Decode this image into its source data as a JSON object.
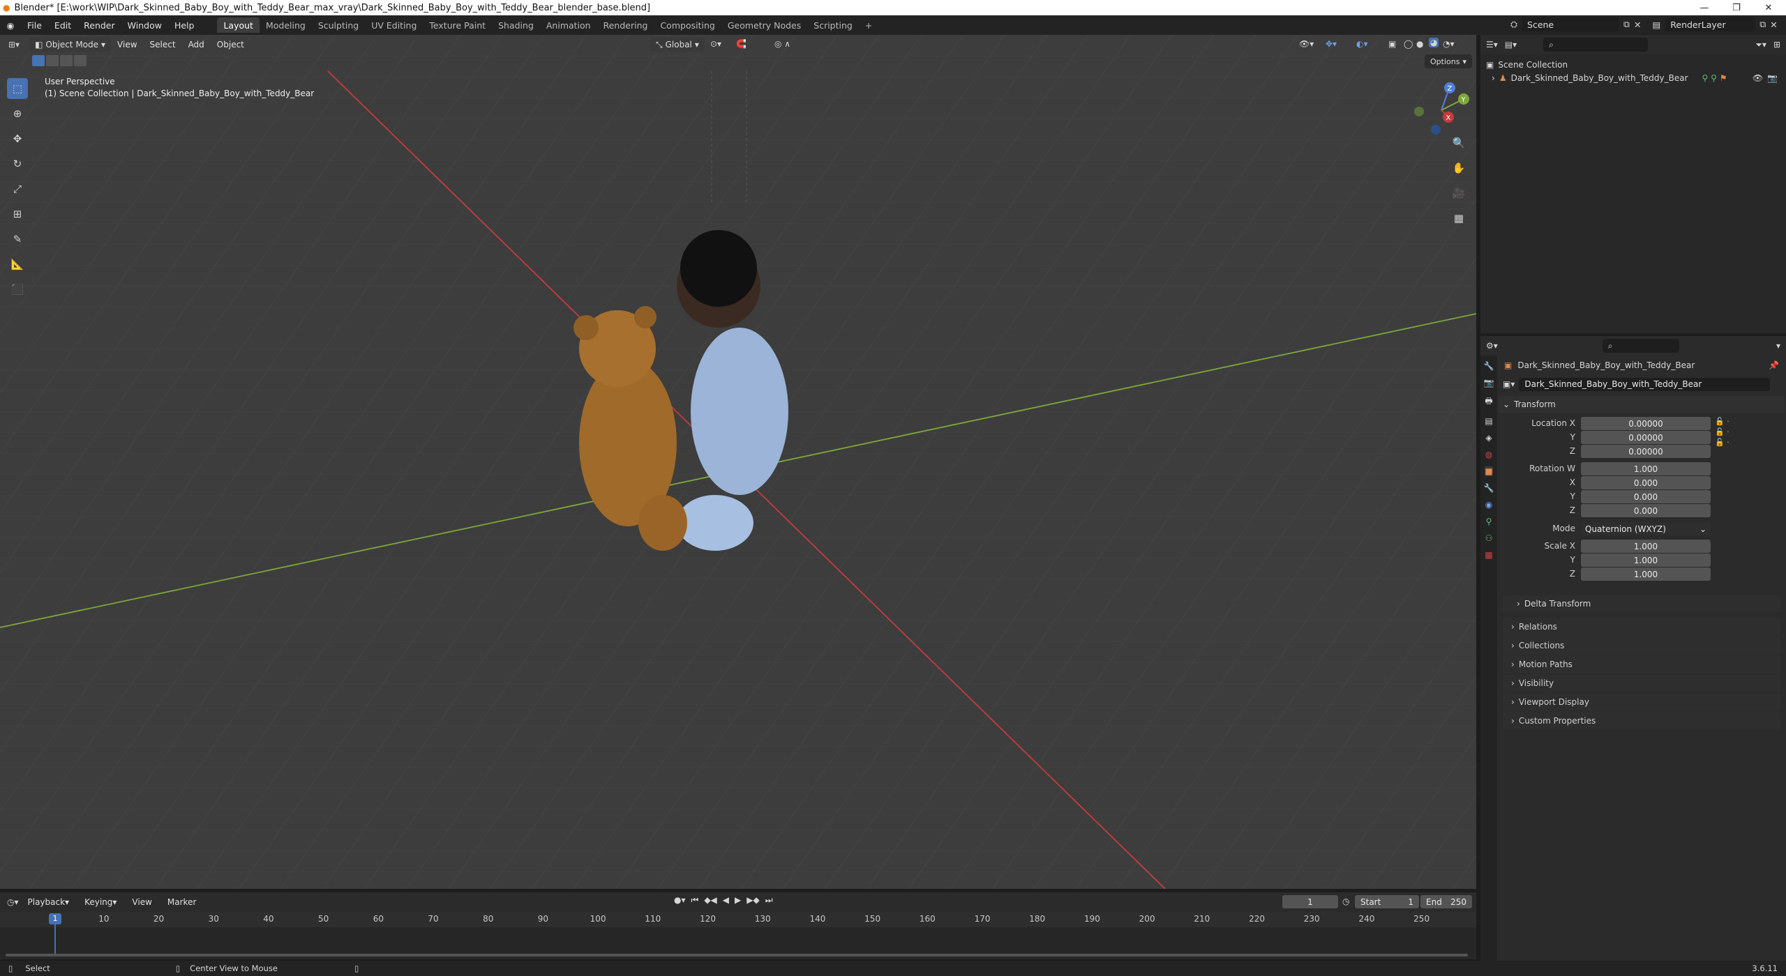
{
  "window": {
    "title": "Blender* [E:\\work\\WIP\\Dark_Skinned_Baby_Boy_with_Teddy_Bear_max_vray\\Dark_Skinned_Baby_Boy_with_Teddy_Bear_blender_base.blend]"
  },
  "menu": [
    "File",
    "Edit",
    "Render",
    "Window",
    "Help"
  ],
  "workspaces": [
    "Layout",
    "Modeling",
    "Sculpting",
    "UV Editing",
    "Texture Paint",
    "Shading",
    "Animation",
    "Rendering",
    "Compositing",
    "Geometry Nodes",
    "Scripting"
  ],
  "scene": {
    "name": "Scene",
    "render_layer": "RenderLayer"
  },
  "viewport": {
    "mode": "Object Mode",
    "menus": [
      "View",
      "Select",
      "Add",
      "Object"
    ],
    "transform_orientation": "Global",
    "options_label": "Options",
    "perspective": "User Perspective",
    "collection_info": "(1) Scene Collection | Dark_Skinned_Baby_Boy_with_Teddy_Bear"
  },
  "outliner": {
    "root": "Scene Collection",
    "items": [
      {
        "name": "Dark_Skinned_Baby_Boy_with_Teddy_Bear"
      }
    ]
  },
  "properties": {
    "object_name": "Dark_Skinned_Baby_Boy_with_Teddy_Bear",
    "object_field": "Dark_Skinned_Baby_Boy_with_Teddy_Bear",
    "transform_title": "Transform",
    "location_label": "Location X",
    "location": [
      "0.00000",
      "0.00000",
      "0.00000"
    ],
    "rotation_label": "Rotation W",
    "rotation": [
      "1.000",
      "0.000",
      "0.000",
      "0.000"
    ],
    "mode_label": "Mode",
    "mode_value": "Quaternion (WXYZ)",
    "scale_label": "Scale X",
    "scale": [
      "1.000",
      "1.000",
      "1.000"
    ],
    "axis_y": "Y",
    "axis_z": "Z",
    "axis_x": "X",
    "delta_transform": "Delta Transform",
    "panels": [
      "Relations",
      "Collections",
      "Motion Paths",
      "Visibility",
      "Viewport Display",
      "Custom Properties"
    ]
  },
  "timeline": {
    "menus": [
      "Playback",
      "Keying",
      "View",
      "Marker"
    ],
    "current_frame": "1",
    "start_label": "Start",
    "start": "1",
    "end_label": "End",
    "end": "250",
    "ticks": [
      "1",
      "10",
      "20",
      "30",
      "40",
      "50",
      "60",
      "70",
      "80",
      "90",
      "100",
      "110",
      "120",
      "130",
      "140",
      "150",
      "160",
      "170",
      "180",
      "190",
      "200",
      "210",
      "220",
      "230",
      "240",
      "250"
    ]
  },
  "statusbar": {
    "select": "Select",
    "center_view": "Center View to Mouse",
    "version": "3.6.11"
  },
  "colors": {
    "accent": "#4772b3",
    "x_axis": "#c43c3c",
    "y_axis": "#7fa83a",
    "viewport_bg": "#3d3d3d"
  }
}
